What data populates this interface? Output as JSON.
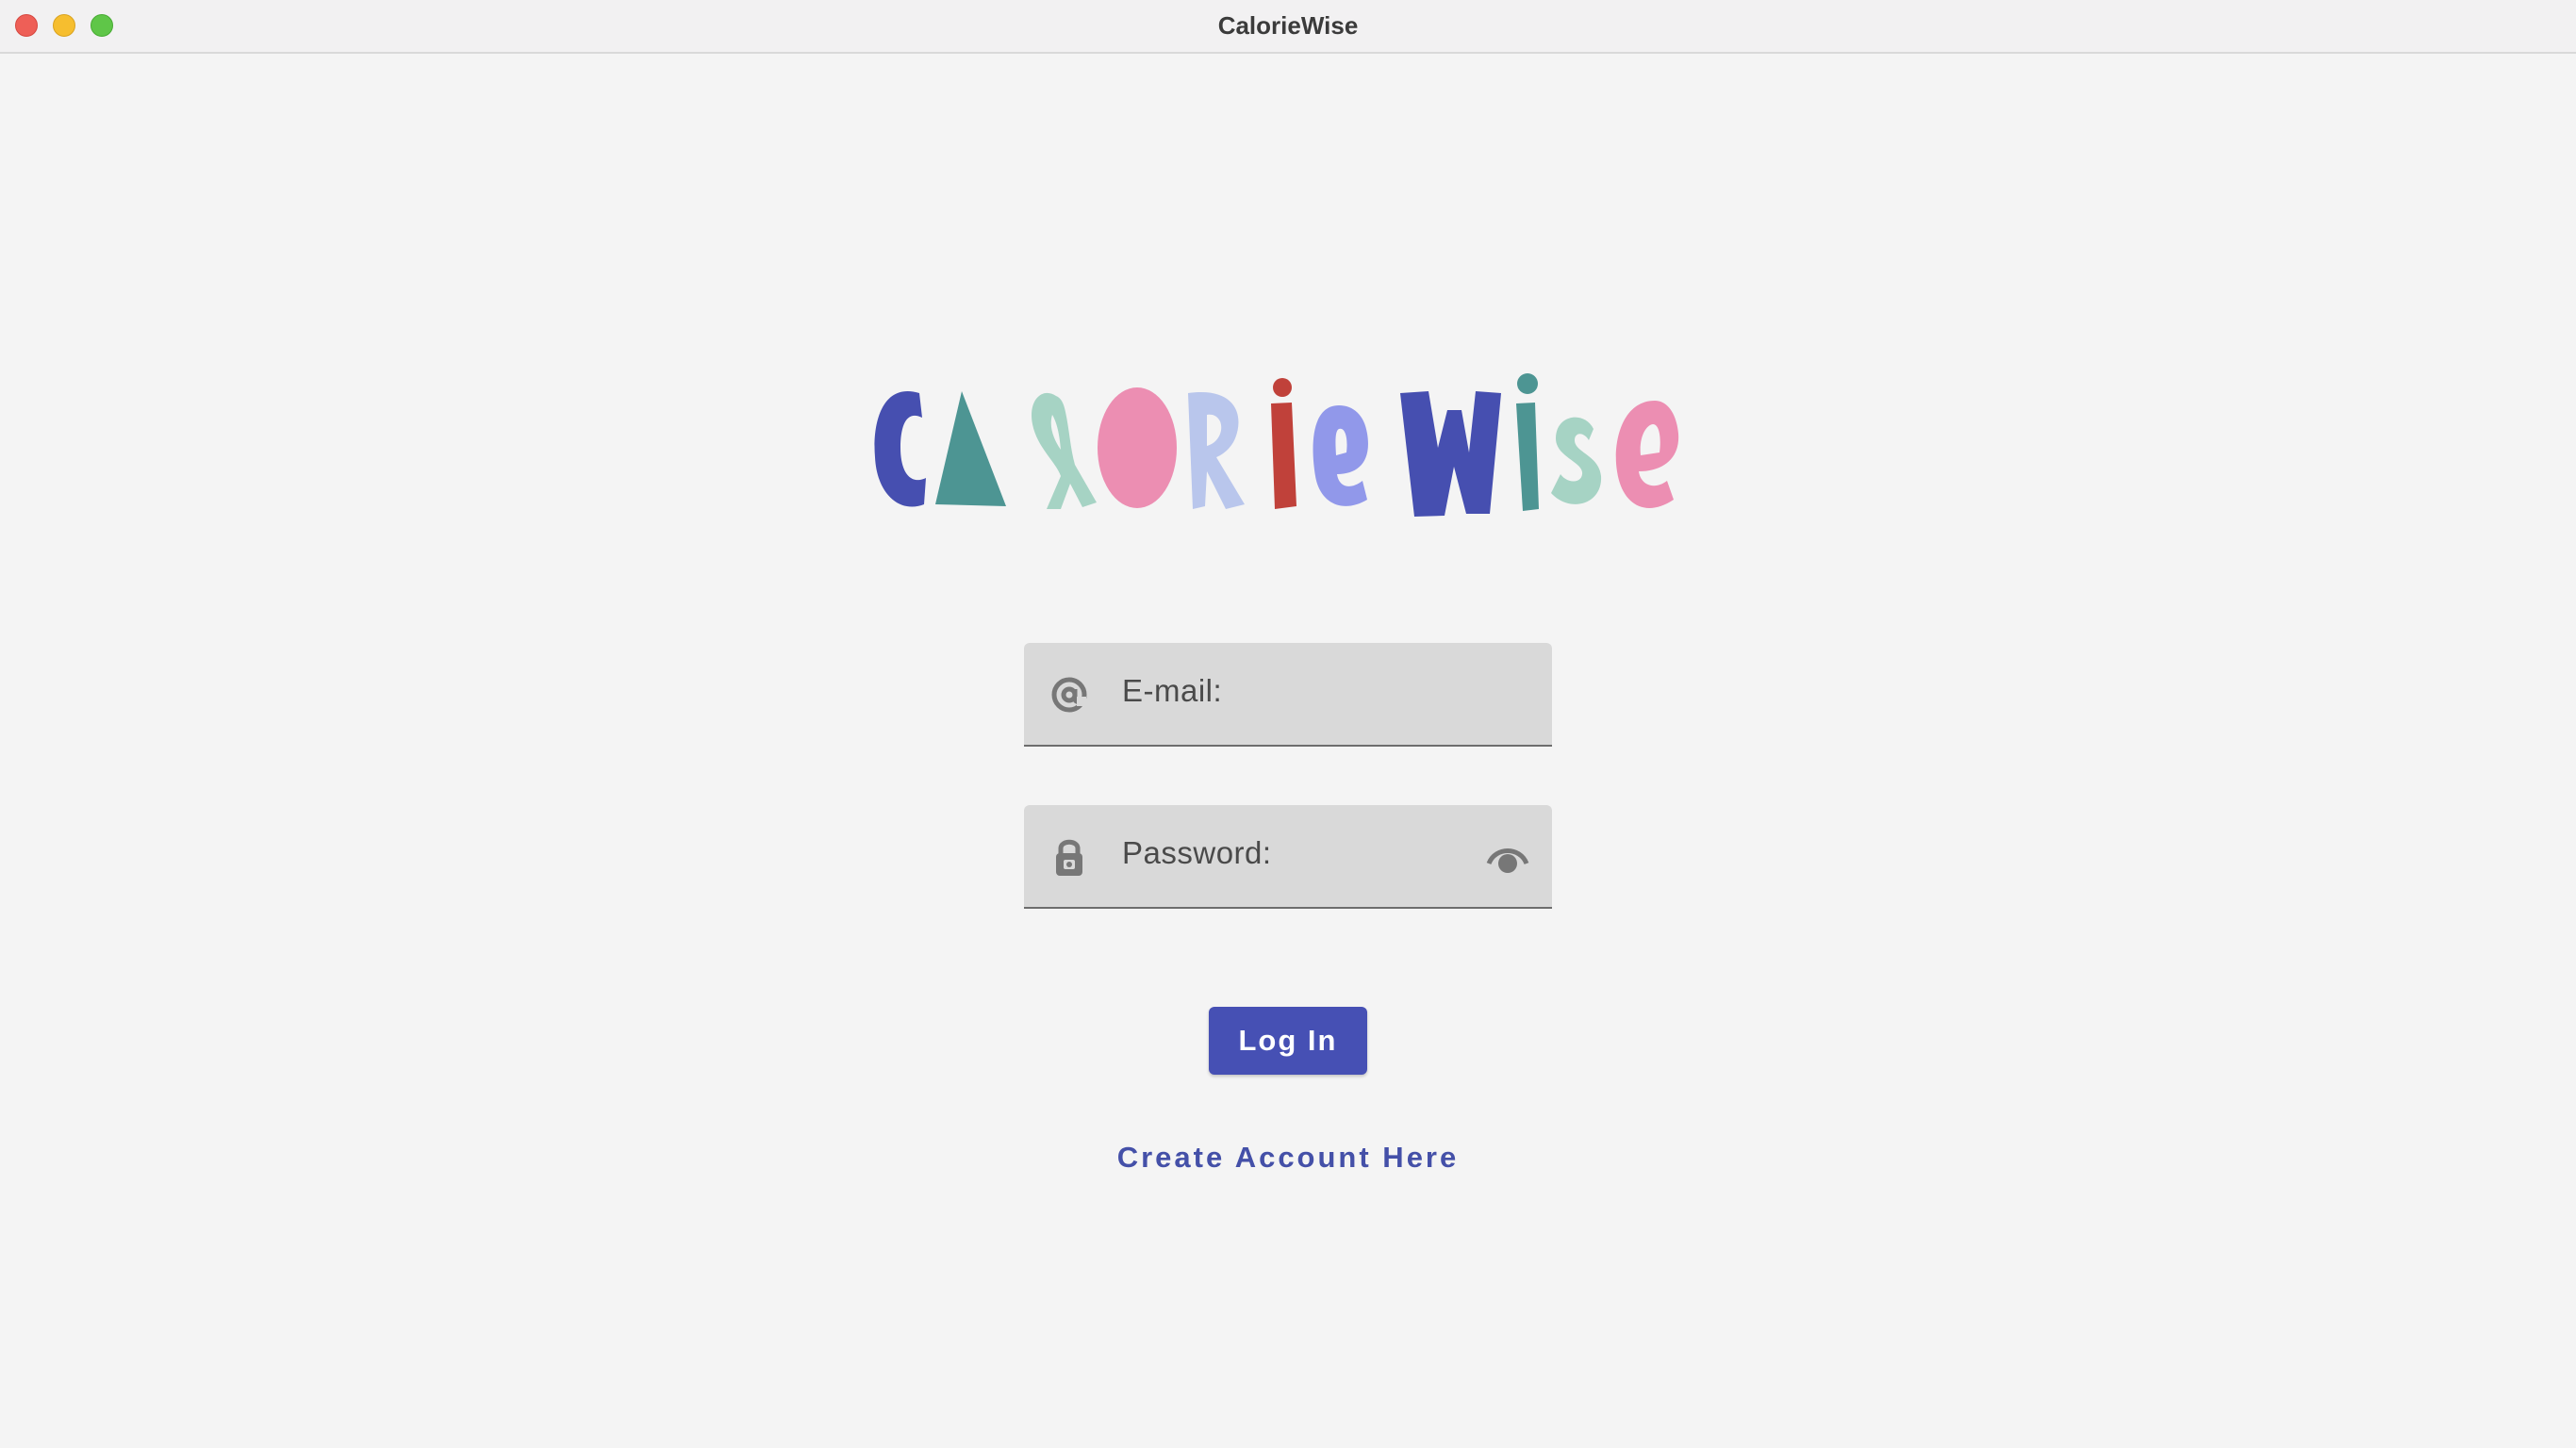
{
  "window": {
    "title": "CalorieWise"
  },
  "logo": {
    "text": "CalorieWise"
  },
  "email_field": {
    "label": "E-mail:",
    "icon": "at-icon"
  },
  "password_field": {
    "label": "Password:",
    "icon": "lock-icon",
    "toggle_icon": "eye-icon"
  },
  "actions": {
    "login_label": "Log In",
    "create_account_label": "Create Account Here"
  },
  "colors": {
    "accent": "#4650b4",
    "link": "#4450a8",
    "field_bg": "#d9d9d9",
    "background": "#f4f4f4"
  }
}
